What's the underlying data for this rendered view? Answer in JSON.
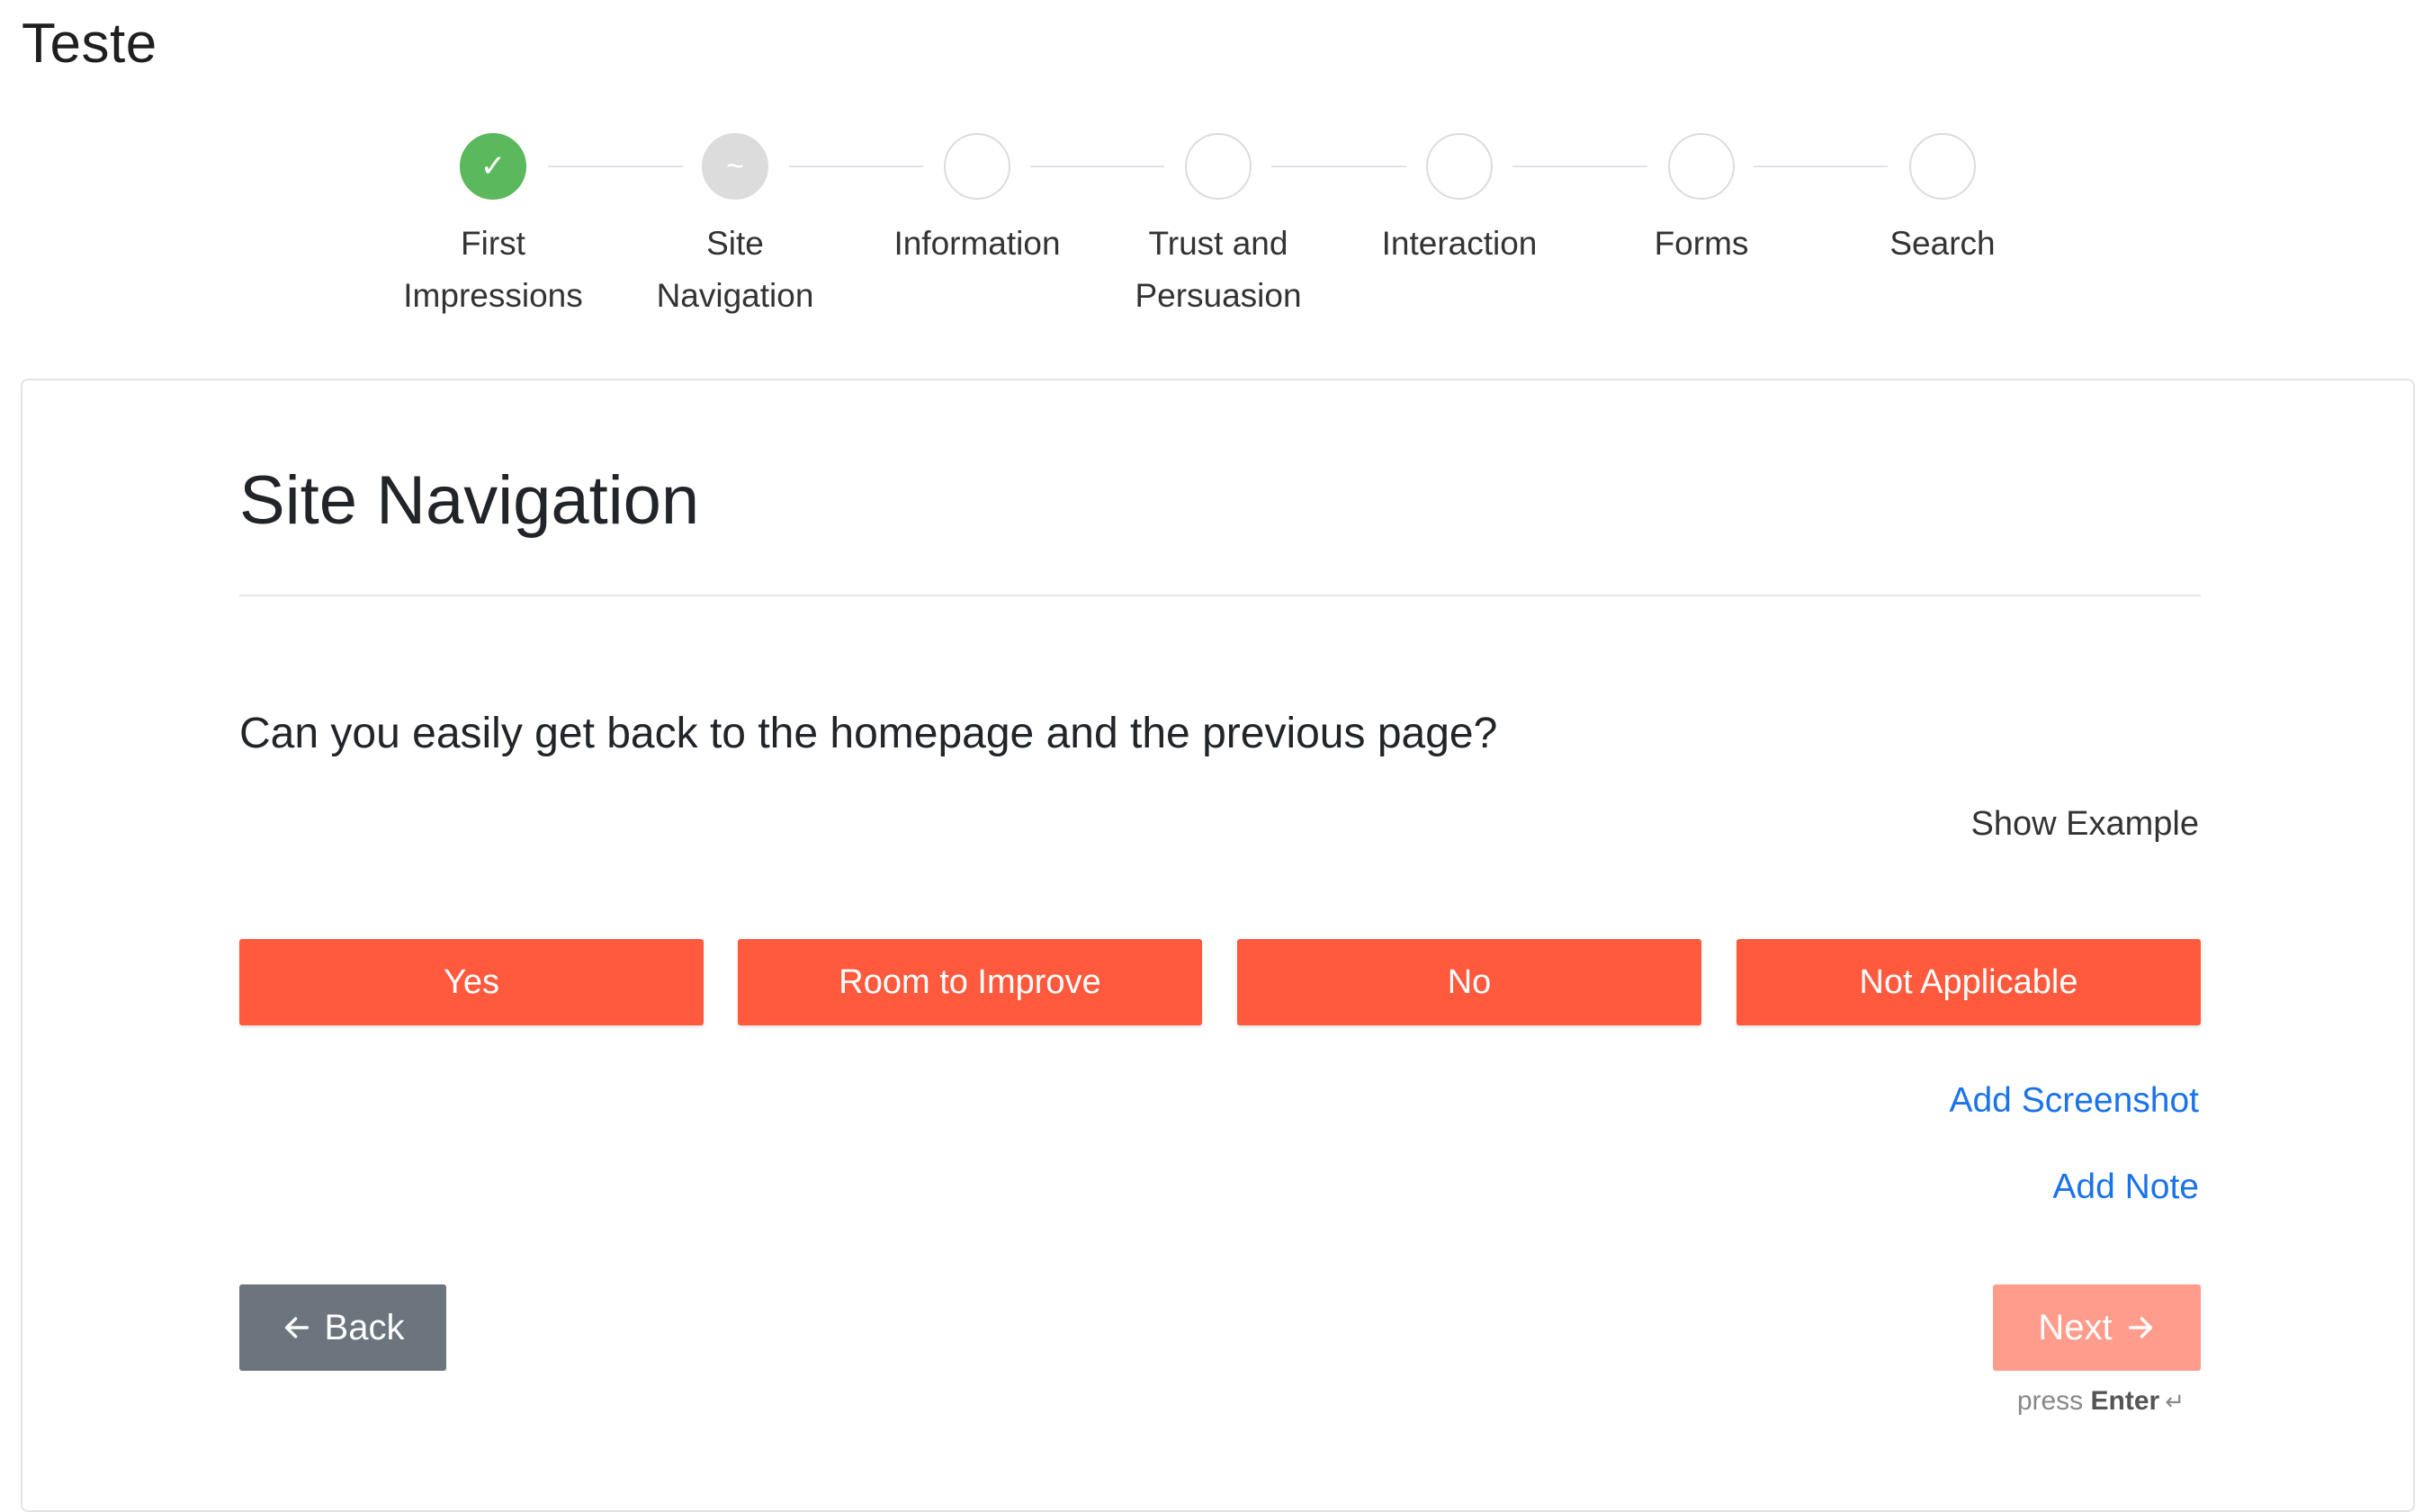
{
  "app": {
    "title": "Teste"
  },
  "stepper": {
    "steps": [
      {
        "line1": "First",
        "line2": "Impressions",
        "status": "done"
      },
      {
        "line1": "Site",
        "line2": "Navigation",
        "status": "current"
      },
      {
        "line1": "Information",
        "line2": "",
        "status": "todo"
      },
      {
        "line1": "Trust and",
        "line2": "Persuasion",
        "status": "todo"
      },
      {
        "line1": "Interaction",
        "line2": "",
        "status": "todo"
      },
      {
        "line1": "Forms",
        "line2": "",
        "status": "todo"
      },
      {
        "line1": "Search",
        "line2": "",
        "status": "todo"
      }
    ],
    "done_icon": "✓",
    "current_icon": "~"
  },
  "section": {
    "title": "Site Navigation",
    "question": "Can you easily get back to the homepage and the previous page?",
    "show_example": "Show Example"
  },
  "answers": [
    "Yes",
    "Room to Improve",
    "No",
    "Not Applicable"
  ],
  "links": {
    "add_screenshot": "Add Screenshot",
    "add_note": "Add Note"
  },
  "nav": {
    "back_label": "Back",
    "next_label": "Next",
    "press_prefix": "press",
    "press_key": "Enter",
    "return_icon": "↵"
  },
  "colors": {
    "accent": "#ff5a3d",
    "next_disabled": "#ff9c8b",
    "back": "#6c757d",
    "done": "#5cb85c",
    "link": "#1a73e8"
  }
}
